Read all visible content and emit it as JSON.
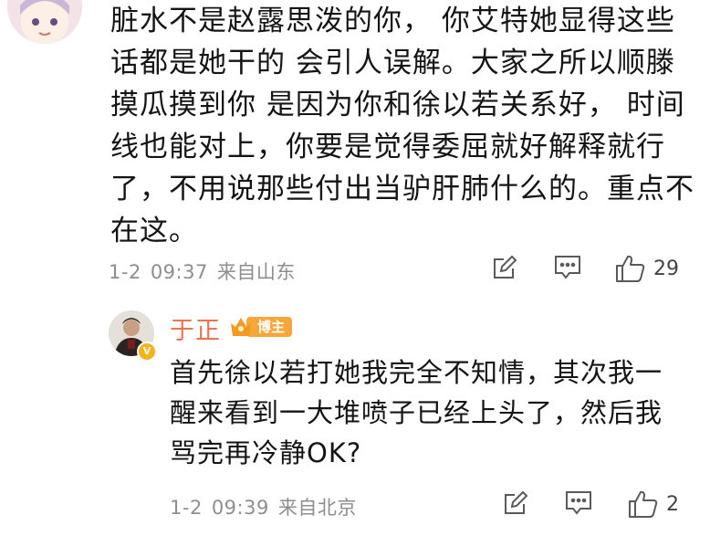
{
  "comment": {
    "text": "脏水不是赵露思泼的你， 你艾特她显得这些话都是她干的 会引人误解。大家之所以顺滕摸瓜摸到你 是因为你和徐以若关系好， 时间线也能对上，你要是觉得委屈就好解释就行了，不用说那些付出当驴肝肺什么的。重点不在这。",
    "date": "1-2",
    "time": "09:37",
    "location": "来自山东",
    "likes": "29",
    "icons": [
      "edit-icon",
      "comment-icon",
      "thumbs-up-icon"
    ]
  },
  "reply": {
    "name": "于正",
    "badge": "博主",
    "text": "首先徐以若打她我完全不知情，其次我一醒来看到一大堆喷子已经上头了，然后我骂完再冷静OK?",
    "date": "1-2",
    "time": "09:39",
    "location": "来自北京",
    "likes": "2",
    "icons": [
      "edit-icon",
      "comment-icon",
      "thumbs-up-icon"
    ]
  },
  "colors": {
    "name": "#eb7350",
    "meta": "#8e8e8e",
    "badge": "#f7a63a",
    "verified": "#f6b21a"
  }
}
